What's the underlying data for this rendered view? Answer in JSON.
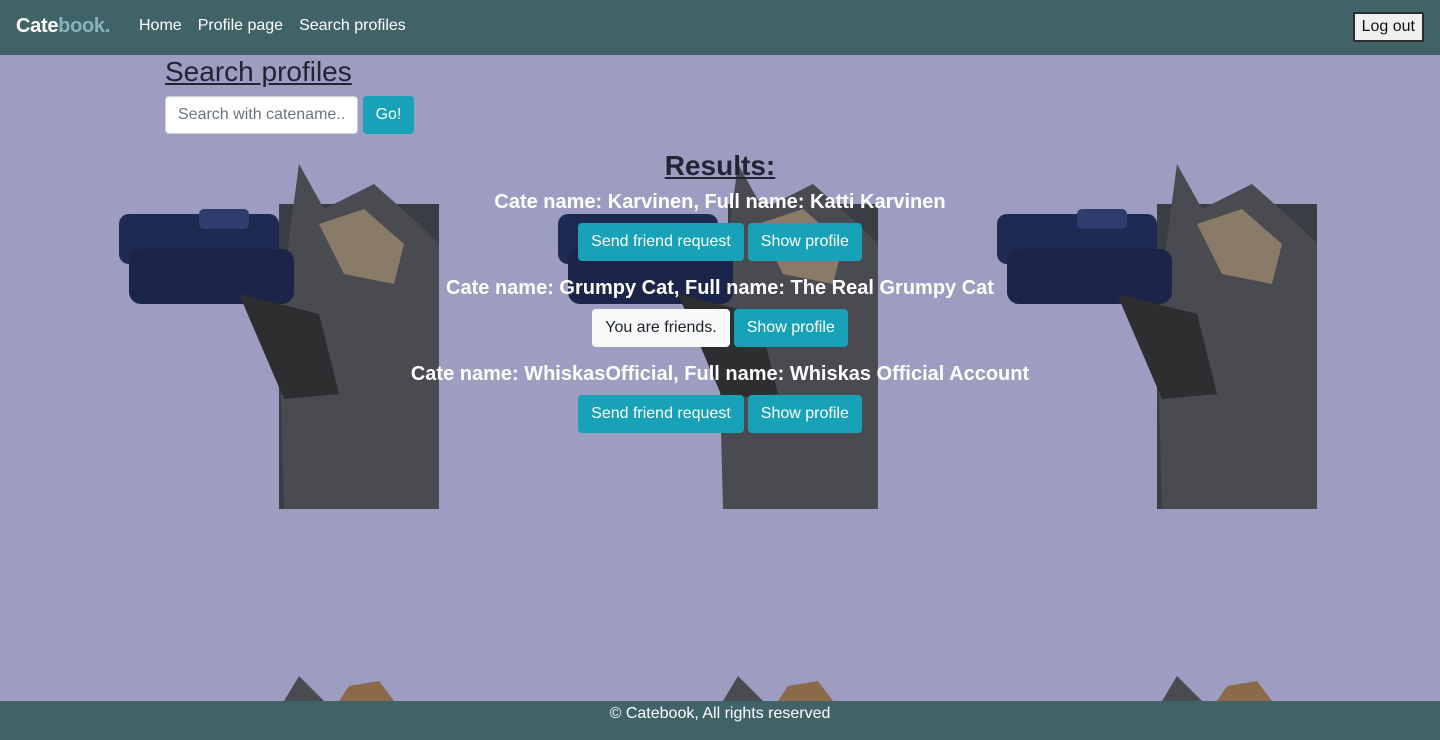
{
  "navbar": {
    "brand_part1": "Cate",
    "brand_part2": "book.",
    "links": [
      "Home",
      "Profile page",
      "Search profiles"
    ],
    "logout_label": "Log out"
  },
  "search": {
    "title": "Search profiles",
    "placeholder": "Search with catename..",
    "go_label": "Go!"
  },
  "results": {
    "title": "Results:",
    "items": [
      {
        "name": "Cate name: Karvinen, Full name: Katti Karvinen",
        "action_label": "Send friend request",
        "profile_label": "Show profile"
      },
      {
        "name": "Cate name: Grumpy Cat, Full name: The Real Grumpy Cat",
        "action_label": "You are friends.",
        "profile_label": "Show profile"
      },
      {
        "name": "Cate name: WhiskasOfficial, Full name: Whiskas Official Account",
        "action_label": "Send friend request",
        "profile_label": "Show profile"
      }
    ]
  },
  "footer": {
    "text": "© Catebook, All rights reserved"
  },
  "colors": {
    "background": "#9d9dc2",
    "navbar": "#406368",
    "accent": "#17a2b8"
  }
}
